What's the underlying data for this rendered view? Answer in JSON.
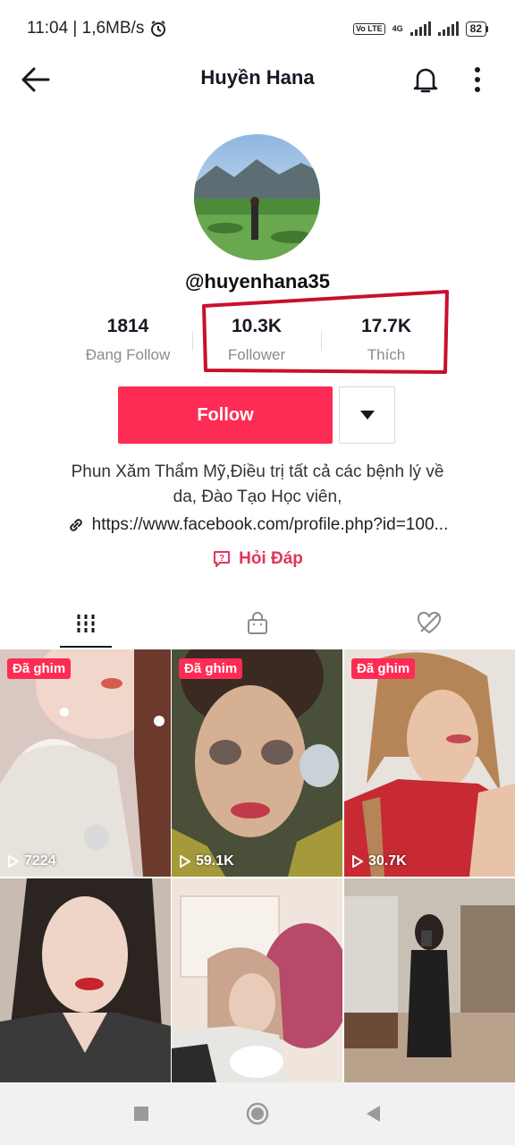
{
  "status_bar": {
    "time_speed": "11:04 | 1,6MB/s",
    "network": "4G",
    "volte": "Vo LTE",
    "battery": "82"
  },
  "header": {
    "title": "Huyền Hana",
    "back_icon": "arrow-left-icon",
    "bell_icon": "bell-icon",
    "more_icon": "vertical-dots-icon"
  },
  "profile": {
    "username": "@huyenhana35",
    "stats": [
      {
        "value": "1814",
        "label": "Đang Follow"
      },
      {
        "value": "10.3K",
        "label": "Follower"
      },
      {
        "value": "17.7K",
        "label": "Thích"
      }
    ],
    "follow_label": "Follow",
    "bio_line1": "Phun Xăm Thẩm Mỹ,Điều trị tất cả các bệnh lý về",
    "bio_line2": "da, Đào Tạo Học viên,",
    "link": "https://www.facebook.com/profile.php?id=100...",
    "qa_label": "Hỏi Đáp"
  },
  "tabs": [
    {
      "icon": "grid-icon",
      "active": true
    },
    {
      "icon": "lock-bag-icon",
      "active": false
    },
    {
      "icon": "hidden-heart-icon",
      "active": false
    }
  ],
  "videos": [
    {
      "badge": "Đã ghim",
      "views": "7224"
    },
    {
      "badge": "Đã ghim",
      "views": "59.1K"
    },
    {
      "badge": "Đã ghim",
      "views": "30.7K"
    },
    {
      "badge": "",
      "views": ""
    },
    {
      "badge": "",
      "views": ""
    },
    {
      "badge": "",
      "views": ""
    }
  ],
  "colors": {
    "accent": "#fe2c55",
    "highlight": "#c8102e"
  }
}
